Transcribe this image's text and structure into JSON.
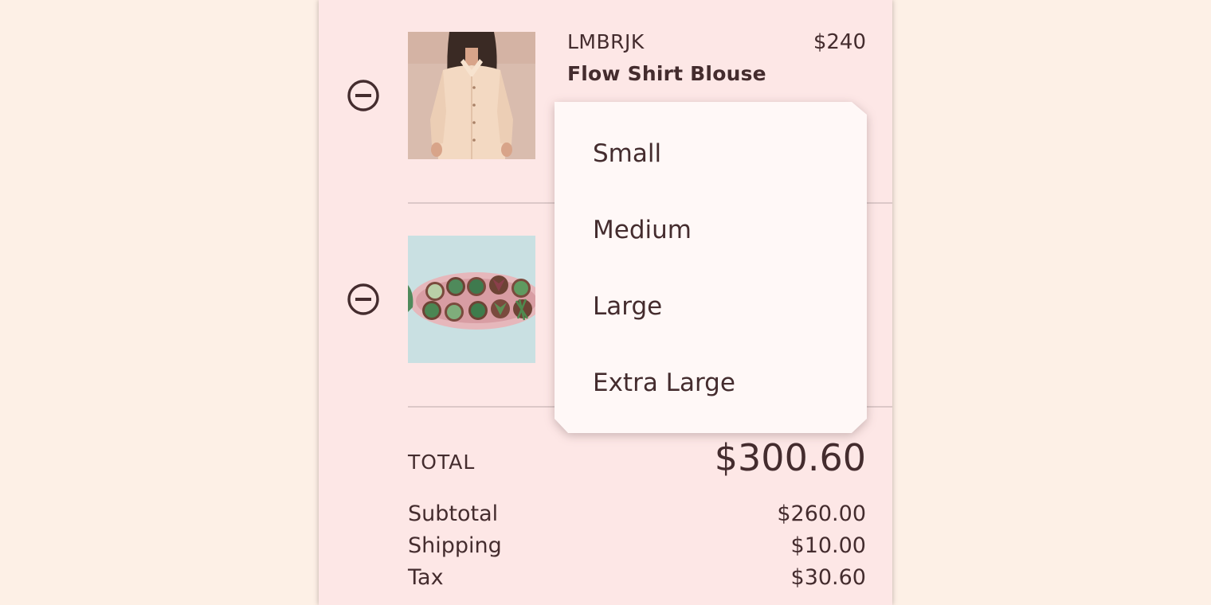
{
  "cart": {
    "items": [
      {
        "brand": "LMBRJK",
        "name": "Flow Shirt Blouse",
        "price": "$240",
        "remove_icon": "remove-circle-icon",
        "image": "blouse-photo"
      },
      {
        "remove_icon": "remove-circle-icon",
        "image": "succulent-plants-photo"
      }
    ],
    "total_label": "TOTAL",
    "total_value": "$300.60",
    "summary": [
      {
        "label": "Subtotal",
        "value": "$260.00"
      },
      {
        "label": "Shipping",
        "value": "$10.00"
      },
      {
        "label": "Tax",
        "value": "$30.60"
      }
    ]
  },
  "size_menu": {
    "options": [
      "Small",
      "Medium",
      "Large",
      "Extra Large"
    ]
  },
  "colors": {
    "page_background": "#fdf0e6",
    "panel_background": "#fde7e6",
    "menu_background": "#fff8f7",
    "text": "#442c2e",
    "divider": "#dcc8c8"
  }
}
